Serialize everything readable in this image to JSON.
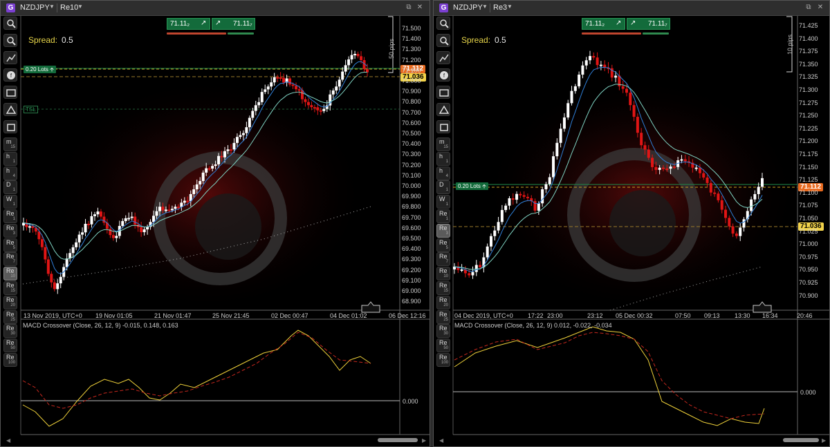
{
  "left": {
    "symbol": "NZDJPY",
    "timeframe": "Re10",
    "spread_label": "Spread:",
    "spread_value": "0.5",
    "sell_price": "71.11₂",
    "buy_price": "71.11₇",
    "position_label": "0.20 Lots 🡩",
    "tsl_label": "TSL",
    "pips_label": "50 pips",
    "current_price_tag": "71.112",
    "entry_price_tag": "71.036",
    "price_axis": [
      "71.500",
      "71.400",
      "71.300",
      "71.200",
      "71.100",
      "71.000",
      "70.900",
      "70.800",
      "70.700",
      "70.600",
      "70.500",
      "70.400",
      "70.300",
      "70.200",
      "70.100",
      "70.000",
      "69.900",
      "69.800",
      "69.700",
      "69.600",
      "69.500",
      "69.400",
      "69.300",
      "69.200",
      "69.100",
      "69.000",
      "68.900"
    ],
    "time_axis": [
      "13 Nov 2019, UTC+0",
      "19 Nov 01:05",
      "21 Nov 01:47",
      "25 Nov 21:45",
      "02 Dec 00:47",
      "04 Dec 01:02",
      "06 Dec 12:16"
    ],
    "macd_title": "MACD Crossover (Close, 26, 12, 9) -0.015, 0.148, 0.163",
    "macd_zero": "0.000",
    "toolbar": [
      "m|15",
      "h|1",
      "h|4",
      "D|1",
      "W|1",
      "Re|1",
      "Re|3",
      "Re|5",
      "Re|7",
      "Re|10",
      "Re|15",
      "Re|20",
      "Re|25",
      "Re|30",
      "Re|50",
      "Re|100"
    ],
    "active_tf": "Re|10"
  },
  "right": {
    "symbol": "NZDJPY",
    "timeframe": "Re3",
    "spread_label": "Spread:",
    "spread_value": "0.5",
    "sell_price": "71.11₂",
    "buy_price": "71.11₇",
    "position_label": "0.20 Lots 🡩",
    "pips_label": "10 pips",
    "current_price_tag": "71.112",
    "entry_price_tag": "71.036",
    "price_axis": [
      "71.425",
      "71.400",
      "71.375",
      "71.350",
      "71.325",
      "71.300",
      "71.275",
      "71.250",
      "71.225",
      "71.200",
      "71.175",
      "71.150",
      "71.125",
      "71.100",
      "71.075",
      "71.050",
      "71.025",
      "71.000",
      "70.975",
      "70.950",
      "70.925",
      "70.900"
    ],
    "time_axis": [
      "04 Dec 2019, UTC+0",
      "17:22",
      "23:00",
      "23:12",
      "05 Dec 00:32",
      "07:50",
      "09:13",
      "13:30",
      "16:34",
      "20:46"
    ],
    "macd_title": "MACD Crossover (Close, 26, 12, 9) 0.012, -0.022, -0.034",
    "macd_zero": "0.000",
    "toolbar": [
      "m|15",
      "h|1",
      "h|4",
      "D|1",
      "W|1",
      "Re|1",
      "Re|3",
      "Re|5",
      "Re|7",
      "Re|10",
      "Re|15",
      "Re|20",
      "Re|25",
      "Re|30",
      "Re|50",
      "Re|100"
    ],
    "active_tf": "Re|3"
  },
  "colors": {
    "bull": "#ffffff",
    "bear": "#e01515",
    "ema_fast": "#2f7fd8",
    "ema_slow": "#7fd3c3",
    "macd_line": "#f0d23a",
    "signal_line": "#c8281e",
    "green": "#136b3b",
    "orange": "#e86a1f",
    "yellow": "#f2d34a"
  }
}
